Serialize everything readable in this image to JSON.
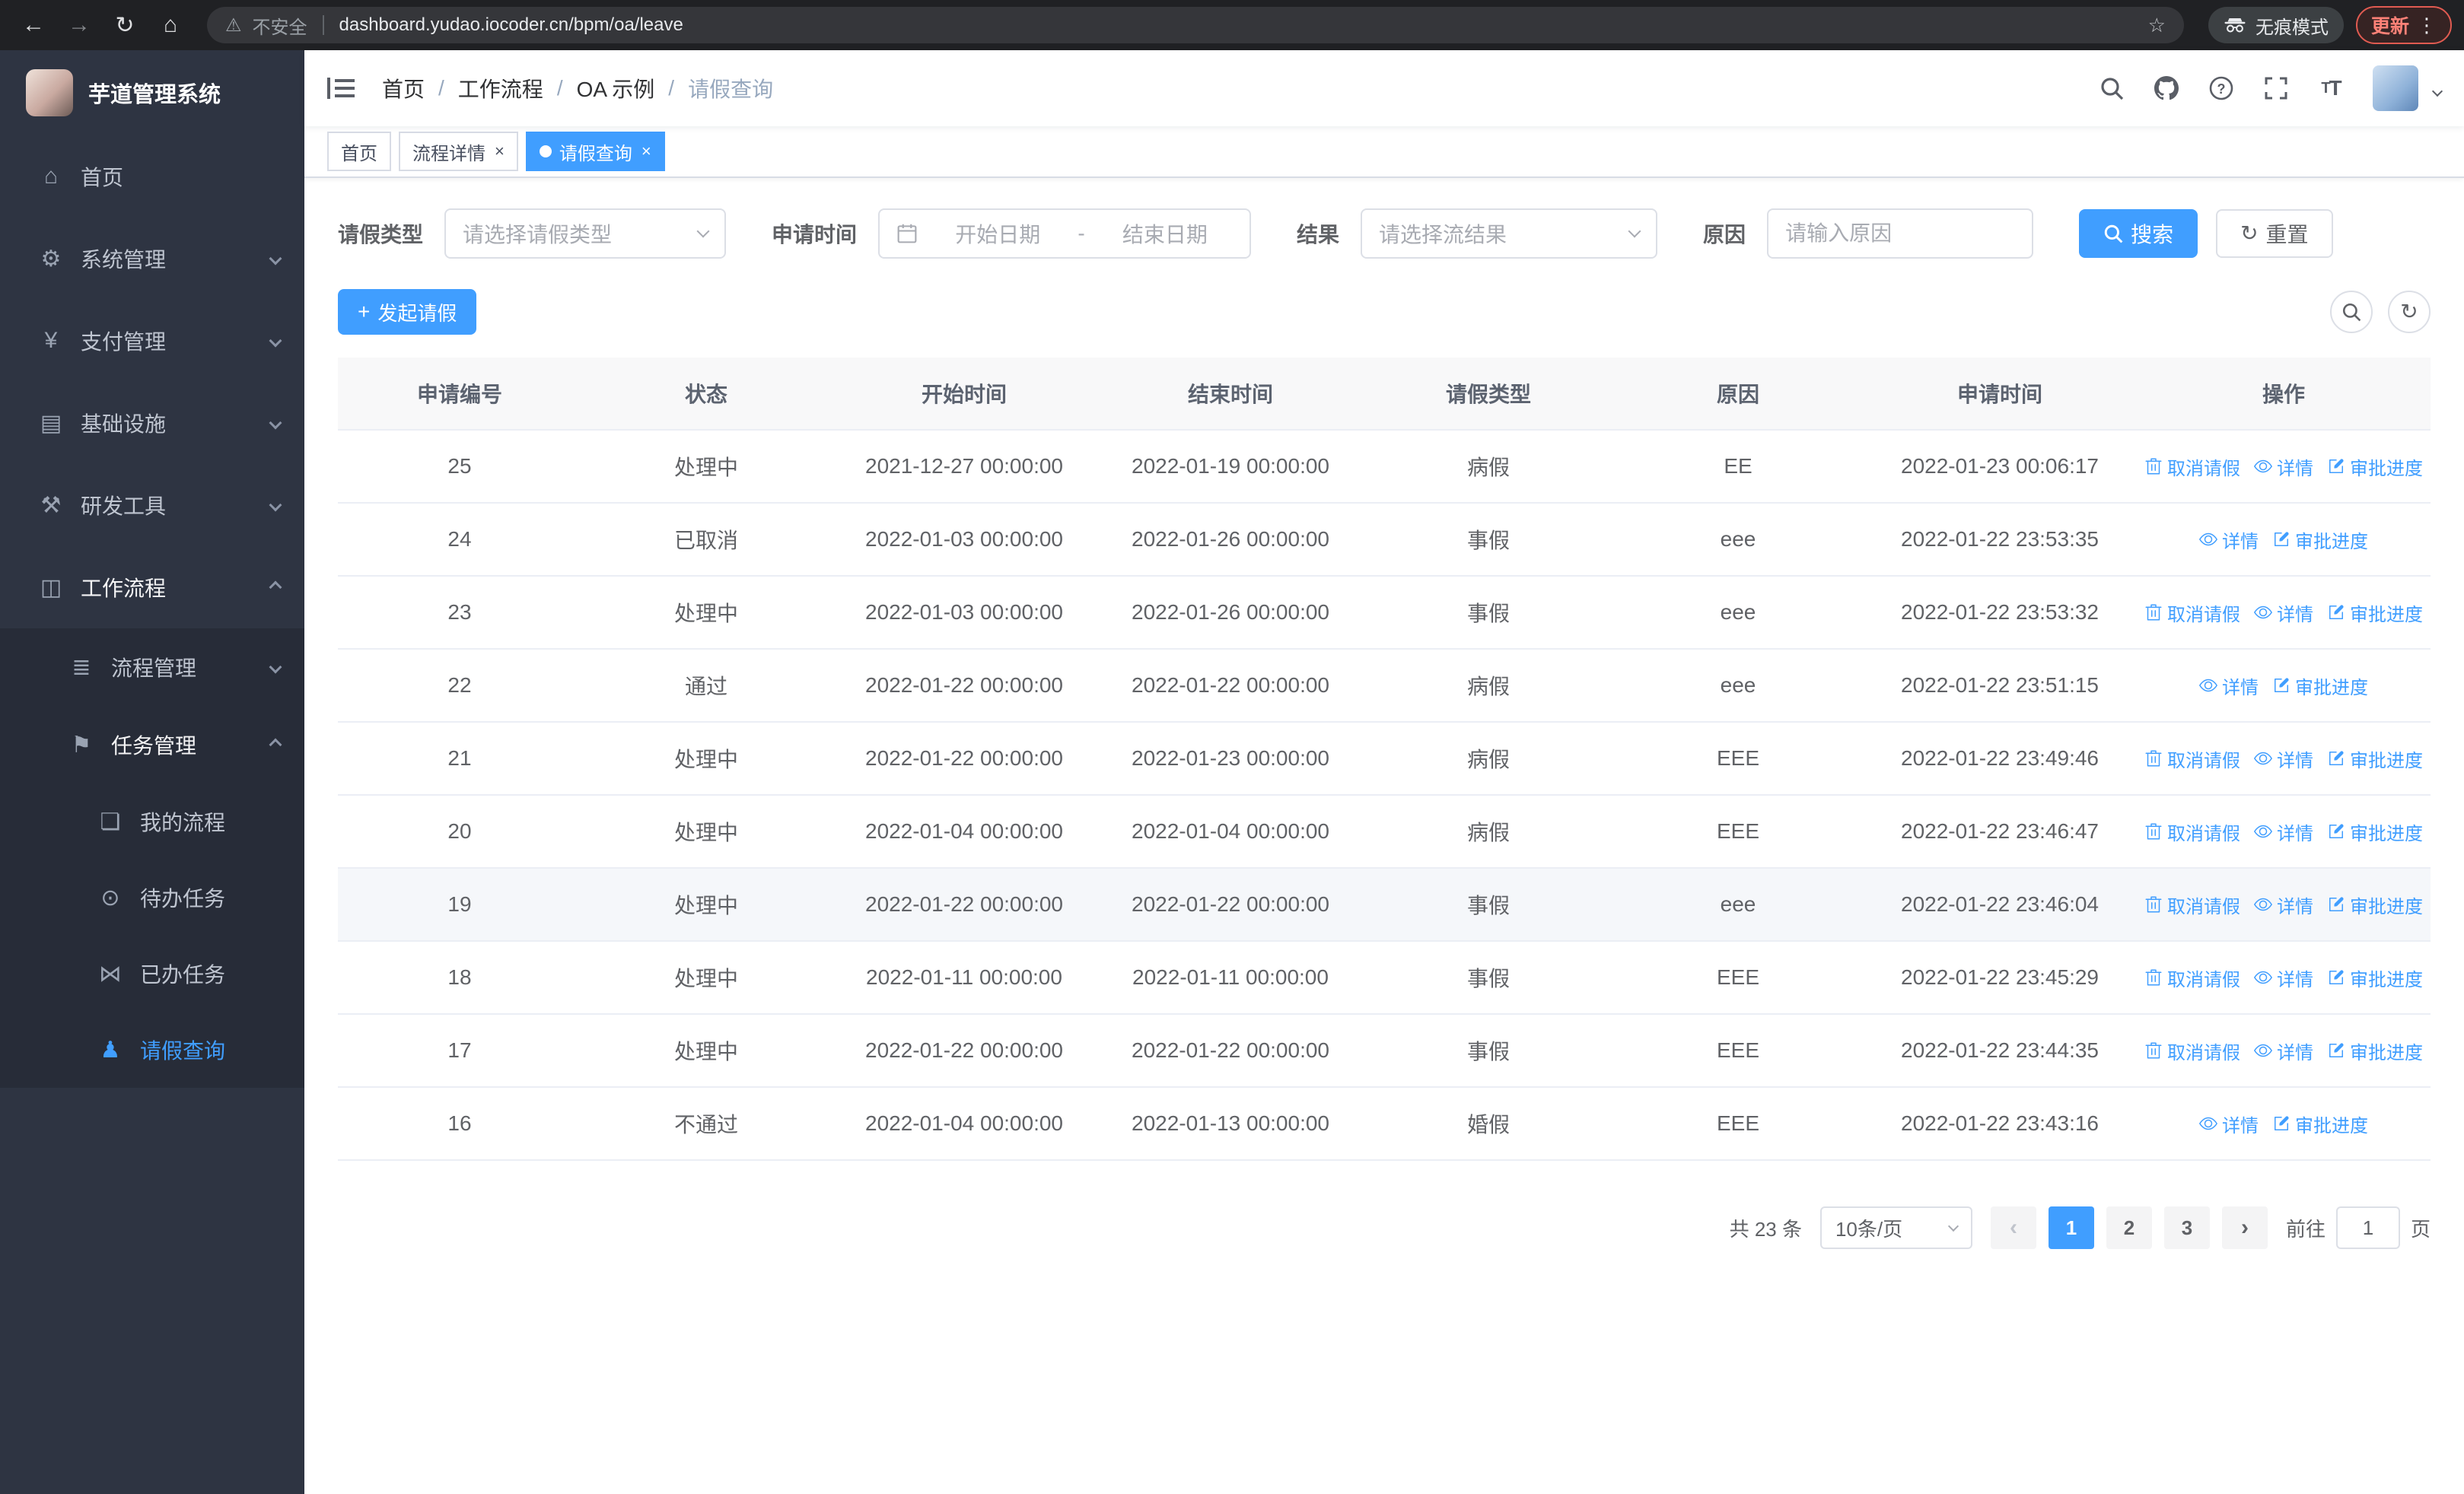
{
  "browser": {
    "security_label": "不安全",
    "url": "dashboard.yudao.iocoder.cn/bpm/oa/leave",
    "incognito_label": "无痕模式",
    "update_label": "更新"
  },
  "sidebar": {
    "title": "芋道管理系统",
    "items": [
      {
        "label": "首页",
        "icon": "⌂"
      },
      {
        "label": "系统管理",
        "icon": "⚙"
      },
      {
        "label": "支付管理",
        "icon": "¥"
      },
      {
        "label": "基础设施",
        "icon": "▤"
      },
      {
        "label": "研发工具",
        "icon": "⚒"
      },
      {
        "label": "工作流程",
        "icon": "◫",
        "children": [
          {
            "label": "流程管理",
            "icon": "≣"
          },
          {
            "label": "任务管理",
            "icon": "⚑",
            "children": [
              {
                "label": "我的流程",
                "icon": "❏"
              },
              {
                "label": "待办任务",
                "icon": "⊙"
              },
              {
                "label": "已办任务",
                "icon": "⋈"
              },
              {
                "label": "请假查询",
                "icon": "♟"
              }
            ]
          }
        ]
      }
    ]
  },
  "header": {
    "breadcrumb": [
      "首页",
      "工作流程",
      "OA 示例",
      "请假查询"
    ]
  },
  "tabs": [
    {
      "label": "首页"
    },
    {
      "label": "流程详情"
    },
    {
      "label": "请假查询"
    }
  ],
  "filters": {
    "leave_type_label": "请假类型",
    "leave_type_placeholder": "请选择请假类型",
    "apply_time_label": "申请时间",
    "start_date_placeholder": "开始日期",
    "range_separator": "-",
    "end_date_placeholder": "结束日期",
    "result_label": "结果",
    "result_placeholder": "请选择流结果",
    "reason_label": "原因",
    "reason_placeholder": "请输入原因",
    "search_label": "搜索",
    "reset_label": "重置"
  },
  "toolbar": {
    "create_label": "发起请假"
  },
  "table": {
    "columns": [
      "申请编号",
      "状态",
      "开始时间",
      "结束时间",
      "请假类型",
      "原因",
      "申请时间",
      "操作"
    ],
    "action_labels": {
      "cancel": "取消请假",
      "detail": "详情",
      "progress": "审批进度"
    },
    "action_icons": {
      "cancel": "delete-icon",
      "detail": "view-icon",
      "progress": "edit-icon"
    },
    "rows": [
      {
        "id": "25",
        "status": "处理中",
        "start": "2021-12-27 00:00:00",
        "end": "2022-01-19 00:00:00",
        "type": "病假",
        "reason": "EE",
        "apply_time": "2022-01-23 00:06:17",
        "actions": [
          "cancel",
          "detail",
          "progress"
        ]
      },
      {
        "id": "24",
        "status": "已取消",
        "start": "2022-01-03 00:00:00",
        "end": "2022-01-26 00:00:00",
        "type": "事假",
        "reason": "eee",
        "apply_time": "2022-01-22 23:53:35",
        "actions": [
          "detail",
          "progress"
        ]
      },
      {
        "id": "23",
        "status": "处理中",
        "start": "2022-01-03 00:00:00",
        "end": "2022-01-26 00:00:00",
        "type": "事假",
        "reason": "eee",
        "apply_time": "2022-01-22 23:53:32",
        "actions": [
          "cancel",
          "detail",
          "progress"
        ]
      },
      {
        "id": "22",
        "status": "通过",
        "start": "2022-01-22 00:00:00",
        "end": "2022-01-22 00:00:00",
        "type": "病假",
        "reason": "eee",
        "apply_time": "2022-01-22 23:51:15",
        "actions": [
          "detail",
          "progress"
        ]
      },
      {
        "id": "21",
        "status": "处理中",
        "start": "2022-01-22 00:00:00",
        "end": "2022-01-23 00:00:00",
        "type": "病假",
        "reason": "EEE",
        "apply_time": "2022-01-22 23:49:46",
        "actions": [
          "cancel",
          "detail",
          "progress"
        ]
      },
      {
        "id": "20",
        "status": "处理中",
        "start": "2022-01-04 00:00:00",
        "end": "2022-01-04 00:00:00",
        "type": "病假",
        "reason": "EEE",
        "apply_time": "2022-01-22 23:46:47",
        "actions": [
          "cancel",
          "detail",
          "progress"
        ]
      },
      {
        "id": "19",
        "status": "处理中",
        "start": "2022-01-22 00:00:00",
        "end": "2022-01-22 00:00:00",
        "type": "事假",
        "reason": "eee",
        "apply_time": "2022-01-22 23:46:04",
        "actions": [
          "cancel",
          "detail",
          "progress"
        ],
        "highlighted": true
      },
      {
        "id": "18",
        "status": "处理中",
        "start": "2022-01-11 00:00:00",
        "end": "2022-01-11 00:00:00",
        "type": "事假",
        "reason": "EEE",
        "apply_time": "2022-01-22 23:45:29",
        "actions": [
          "cancel",
          "detail",
          "progress"
        ]
      },
      {
        "id": "17",
        "status": "处理中",
        "start": "2022-01-22 00:00:00",
        "end": "2022-01-22 00:00:00",
        "type": "事假",
        "reason": "EEE",
        "apply_time": "2022-01-22 23:44:35",
        "actions": [
          "cancel",
          "detail",
          "progress"
        ]
      },
      {
        "id": "16",
        "status": "不通过",
        "start": "2022-01-04 00:00:00",
        "end": "2022-01-13 00:00:00",
        "type": "婚假",
        "reason": "EEE",
        "apply_time": "2022-01-22 23:43:16",
        "actions": [
          "detail",
          "progress"
        ]
      }
    ]
  },
  "pagination": {
    "total": "共 23 条",
    "page_size": "10条/页",
    "pages": [
      "1",
      "2",
      "3"
    ],
    "current": "1",
    "goto_label": "前往",
    "goto_value": "1",
    "goto_suffix": "页"
  },
  "colors": {
    "accent": "#409eff",
    "sidebar_bg": "#2e3442",
    "chrome_bg": "#202124"
  }
}
